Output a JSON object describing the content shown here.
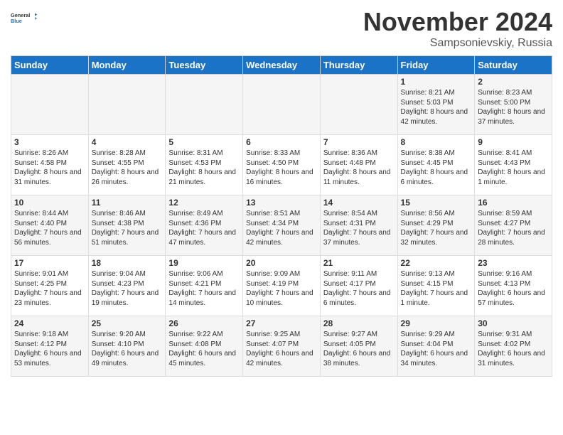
{
  "header": {
    "logo_general": "General",
    "logo_blue": "Blue",
    "month_title": "November 2024",
    "subtitle": "Sampsonievskiy, Russia"
  },
  "days_of_week": [
    "Sunday",
    "Monday",
    "Tuesday",
    "Wednesday",
    "Thursday",
    "Friday",
    "Saturday"
  ],
  "weeks": [
    {
      "days": [
        {
          "number": "",
          "info": ""
        },
        {
          "number": "",
          "info": ""
        },
        {
          "number": "",
          "info": ""
        },
        {
          "number": "",
          "info": ""
        },
        {
          "number": "",
          "info": ""
        },
        {
          "number": "1",
          "info": "Sunrise: 8:21 AM\nSunset: 5:03 PM\nDaylight: 8 hours and 42 minutes."
        },
        {
          "number": "2",
          "info": "Sunrise: 8:23 AM\nSunset: 5:00 PM\nDaylight: 8 hours and 37 minutes."
        }
      ]
    },
    {
      "days": [
        {
          "number": "3",
          "info": "Sunrise: 8:26 AM\nSunset: 4:58 PM\nDaylight: 8 hours and 31 minutes."
        },
        {
          "number": "4",
          "info": "Sunrise: 8:28 AM\nSunset: 4:55 PM\nDaylight: 8 hours and 26 minutes."
        },
        {
          "number": "5",
          "info": "Sunrise: 8:31 AM\nSunset: 4:53 PM\nDaylight: 8 hours and 21 minutes."
        },
        {
          "number": "6",
          "info": "Sunrise: 8:33 AM\nSunset: 4:50 PM\nDaylight: 8 hours and 16 minutes."
        },
        {
          "number": "7",
          "info": "Sunrise: 8:36 AM\nSunset: 4:48 PM\nDaylight: 8 hours and 11 minutes."
        },
        {
          "number": "8",
          "info": "Sunrise: 8:38 AM\nSunset: 4:45 PM\nDaylight: 8 hours and 6 minutes."
        },
        {
          "number": "9",
          "info": "Sunrise: 8:41 AM\nSunset: 4:43 PM\nDaylight: 8 hours and 1 minute."
        }
      ]
    },
    {
      "days": [
        {
          "number": "10",
          "info": "Sunrise: 8:44 AM\nSunset: 4:40 PM\nDaylight: 7 hours and 56 minutes."
        },
        {
          "number": "11",
          "info": "Sunrise: 8:46 AM\nSunset: 4:38 PM\nDaylight: 7 hours and 51 minutes."
        },
        {
          "number": "12",
          "info": "Sunrise: 8:49 AM\nSunset: 4:36 PM\nDaylight: 7 hours and 47 minutes."
        },
        {
          "number": "13",
          "info": "Sunrise: 8:51 AM\nSunset: 4:34 PM\nDaylight: 7 hours and 42 minutes."
        },
        {
          "number": "14",
          "info": "Sunrise: 8:54 AM\nSunset: 4:31 PM\nDaylight: 7 hours and 37 minutes."
        },
        {
          "number": "15",
          "info": "Sunrise: 8:56 AM\nSunset: 4:29 PM\nDaylight: 7 hours and 32 minutes."
        },
        {
          "number": "16",
          "info": "Sunrise: 8:59 AM\nSunset: 4:27 PM\nDaylight: 7 hours and 28 minutes."
        }
      ]
    },
    {
      "days": [
        {
          "number": "17",
          "info": "Sunrise: 9:01 AM\nSunset: 4:25 PM\nDaylight: 7 hours and 23 minutes."
        },
        {
          "number": "18",
          "info": "Sunrise: 9:04 AM\nSunset: 4:23 PM\nDaylight: 7 hours and 19 minutes."
        },
        {
          "number": "19",
          "info": "Sunrise: 9:06 AM\nSunset: 4:21 PM\nDaylight: 7 hours and 14 minutes."
        },
        {
          "number": "20",
          "info": "Sunrise: 9:09 AM\nSunset: 4:19 PM\nDaylight: 7 hours and 10 minutes."
        },
        {
          "number": "21",
          "info": "Sunrise: 9:11 AM\nSunset: 4:17 PM\nDaylight: 7 hours and 6 minutes."
        },
        {
          "number": "22",
          "info": "Sunrise: 9:13 AM\nSunset: 4:15 PM\nDaylight: 7 hours and 1 minute."
        },
        {
          "number": "23",
          "info": "Sunrise: 9:16 AM\nSunset: 4:13 PM\nDaylight: 6 hours and 57 minutes."
        }
      ]
    },
    {
      "days": [
        {
          "number": "24",
          "info": "Sunrise: 9:18 AM\nSunset: 4:12 PM\nDaylight: 6 hours and 53 minutes."
        },
        {
          "number": "25",
          "info": "Sunrise: 9:20 AM\nSunset: 4:10 PM\nDaylight: 6 hours and 49 minutes."
        },
        {
          "number": "26",
          "info": "Sunrise: 9:22 AM\nSunset: 4:08 PM\nDaylight: 6 hours and 45 minutes."
        },
        {
          "number": "27",
          "info": "Sunrise: 9:25 AM\nSunset: 4:07 PM\nDaylight: 6 hours and 42 minutes."
        },
        {
          "number": "28",
          "info": "Sunrise: 9:27 AM\nSunset: 4:05 PM\nDaylight: 6 hours and 38 minutes."
        },
        {
          "number": "29",
          "info": "Sunrise: 9:29 AM\nSunset: 4:04 PM\nDaylight: 6 hours and 34 minutes."
        },
        {
          "number": "30",
          "info": "Sunrise: 9:31 AM\nSunset: 4:02 PM\nDaylight: 6 hours and 31 minutes."
        }
      ]
    }
  ]
}
